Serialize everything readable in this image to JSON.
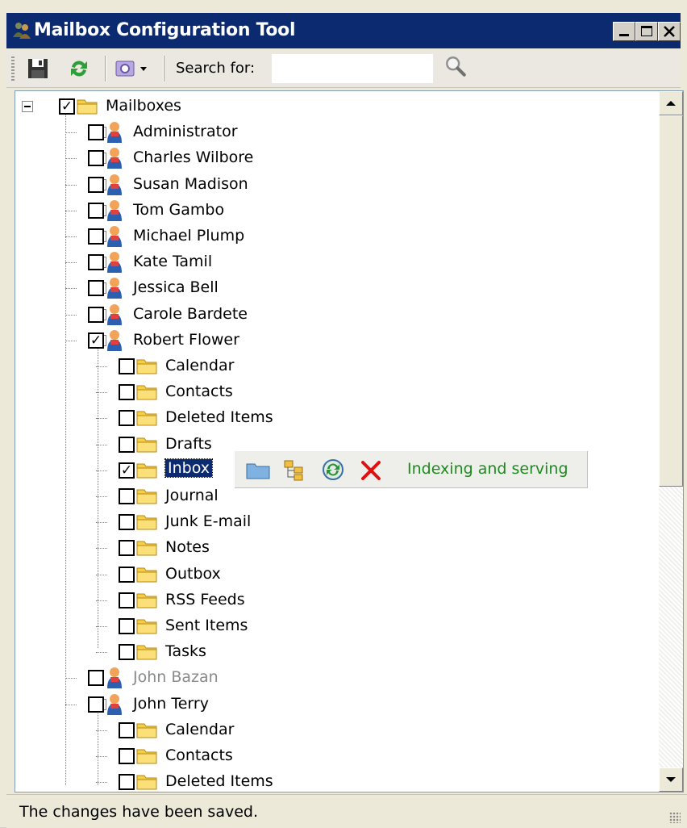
{
  "window": {
    "title": "Mailbox Configuration Tool"
  },
  "toolbar": {
    "search_label": "Search for:",
    "search_value": ""
  },
  "tree": {
    "root": "Mailboxes",
    "rows": [
      {
        "label": "Administrator"
      },
      {
        "label": "Charles Wilbore"
      },
      {
        "label": "Susan Madison"
      },
      {
        "label": "Tom Gambo"
      },
      {
        "label": "Michael Plump"
      },
      {
        "label": "Kate Tamil"
      },
      {
        "label": "Jessica Bell"
      },
      {
        "label": "Carole Bardete"
      },
      {
        "label": "Robert Flower"
      },
      {
        "label": "Calendar"
      },
      {
        "label": "Contacts"
      },
      {
        "label": "Deleted Items"
      },
      {
        "label": "Drafts"
      },
      {
        "label": "Inbox"
      },
      {
        "label": "Journal"
      },
      {
        "label": "Junk E-mail"
      },
      {
        "label": "Notes"
      },
      {
        "label": "Outbox"
      },
      {
        "label": "RSS Feeds"
      },
      {
        "label": "Sent Items"
      },
      {
        "label": "Tasks"
      },
      {
        "label": "John Bazan"
      },
      {
        "label": "John Terry"
      },
      {
        "label": "Calendar"
      },
      {
        "label": "Contacts"
      },
      {
        "label": "Deleted Items"
      }
    ]
  },
  "inbox_actions": {
    "status": "Indexing and serving"
  },
  "status": {
    "text": "The changes have been saved."
  },
  "colors": {
    "title_bg": "#0b2a6f",
    "status_green": "#1f8a1f",
    "selection": "#0b2a6f"
  }
}
